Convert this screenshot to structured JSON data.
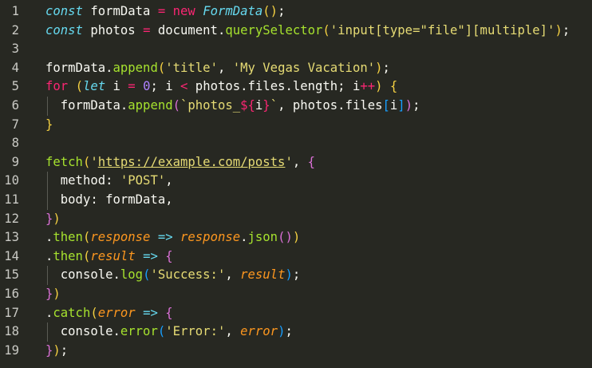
{
  "editor": {
    "colors": {
      "background": "#272822",
      "line_number": "#c9c9c4",
      "keyword": "#66d9ef",
      "control": "#f92672",
      "string": "#e6db74",
      "function": "#a6e22e",
      "parameter": "#fd971f",
      "number": "#ae81ff",
      "bracket_1": "#f5d142",
      "bracket_2": "#da70d6",
      "bracket_3": "#179fff"
    },
    "lines": [
      {
        "num": "1",
        "tokens": [
          {
            "t": "const",
            "c": "kw"
          },
          {
            "t": " formData ",
            "c": "var"
          },
          {
            "t": "=",
            "c": "op"
          },
          {
            "t": " ",
            "c": "var"
          },
          {
            "t": "new",
            "c": "ctrl"
          },
          {
            "t": " ",
            "c": "var"
          },
          {
            "t": "FormData",
            "c": "cls"
          },
          {
            "t": "()",
            "c": "b1"
          },
          {
            "t": ";",
            "c": "punc"
          }
        ]
      },
      {
        "num": "2",
        "tokens": [
          {
            "t": "const",
            "c": "kw"
          },
          {
            "t": " photos ",
            "c": "var"
          },
          {
            "t": "=",
            "c": "op"
          },
          {
            "t": " document.",
            "c": "var"
          },
          {
            "t": "querySelector",
            "c": "fn"
          },
          {
            "t": "(",
            "c": "b1"
          },
          {
            "t": "'input[type=\"file\"][multiple]'",
            "c": "str"
          },
          {
            "t": ")",
            "c": "b1"
          },
          {
            "t": ";",
            "c": "punc"
          }
        ]
      },
      {
        "num": "3",
        "tokens": []
      },
      {
        "num": "4",
        "tokens": [
          {
            "t": "formData.",
            "c": "var"
          },
          {
            "t": "append",
            "c": "fn"
          },
          {
            "t": "(",
            "c": "b1"
          },
          {
            "t": "'title'",
            "c": "str"
          },
          {
            "t": ", ",
            "c": "punc"
          },
          {
            "t": "'My Vegas Vacation'",
            "c": "str"
          },
          {
            "t": ")",
            "c": "b1"
          },
          {
            "t": ";",
            "c": "punc"
          }
        ]
      },
      {
        "num": "5",
        "tokens": [
          {
            "t": "for",
            "c": "ctrl"
          },
          {
            "t": " ",
            "c": "var"
          },
          {
            "t": "(",
            "c": "b1"
          },
          {
            "t": "let",
            "c": "kw"
          },
          {
            "t": " i ",
            "c": "var"
          },
          {
            "t": "=",
            "c": "op"
          },
          {
            "t": " ",
            "c": "var"
          },
          {
            "t": "0",
            "c": "num"
          },
          {
            "t": "; i ",
            "c": "var"
          },
          {
            "t": "<",
            "c": "op"
          },
          {
            "t": " photos.files.length; i",
            "c": "var"
          },
          {
            "t": "++",
            "c": "op"
          },
          {
            "t": ")",
            "c": "b1"
          },
          {
            "t": " ",
            "c": "var"
          },
          {
            "t": "{",
            "c": "b1"
          }
        ]
      },
      {
        "num": "6",
        "guide": true,
        "tokens": [
          {
            "t": "  formData.",
            "c": "var"
          },
          {
            "t": "append",
            "c": "fn"
          },
          {
            "t": "(",
            "c": "b2"
          },
          {
            "t": "`photos_",
            "c": "str"
          },
          {
            "t": "${",
            "c": "ctrl"
          },
          {
            "t": "i",
            "c": "var"
          },
          {
            "t": "}",
            "c": "ctrl"
          },
          {
            "t": "`",
            "c": "str"
          },
          {
            "t": ", photos.files",
            "c": "var"
          },
          {
            "t": "[",
            "c": "b3"
          },
          {
            "t": "i",
            "c": "var"
          },
          {
            "t": "]",
            "c": "b3"
          },
          {
            "t": ")",
            "c": "b2"
          },
          {
            "t": ";",
            "c": "punc"
          }
        ]
      },
      {
        "num": "7",
        "tokens": [
          {
            "t": "}",
            "c": "b1"
          }
        ]
      },
      {
        "num": "8",
        "tokens": []
      },
      {
        "num": "9",
        "tokens": [
          {
            "t": "fetch",
            "c": "fn"
          },
          {
            "t": "(",
            "c": "b1"
          },
          {
            "t": "'",
            "c": "str"
          },
          {
            "t": "https://example.com/posts",
            "c": "url"
          },
          {
            "t": "'",
            "c": "str"
          },
          {
            "t": ", ",
            "c": "punc"
          },
          {
            "t": "{",
            "c": "b2"
          }
        ]
      },
      {
        "num": "10",
        "guide": true,
        "tokens": [
          {
            "t": "  method: ",
            "c": "var"
          },
          {
            "t": "'POST'",
            "c": "str"
          },
          {
            "t": ",",
            "c": "punc"
          }
        ]
      },
      {
        "num": "11",
        "guide": true,
        "tokens": [
          {
            "t": "  body: formData,",
            "c": "var"
          }
        ]
      },
      {
        "num": "12",
        "tokens": [
          {
            "t": "}",
            "c": "b2"
          },
          {
            "t": ")",
            "c": "b1"
          }
        ]
      },
      {
        "num": "13",
        "tokens": [
          {
            "t": ".",
            "c": "punc"
          },
          {
            "t": "then",
            "c": "fn"
          },
          {
            "t": "(",
            "c": "b1"
          },
          {
            "t": "response",
            "c": "param"
          },
          {
            "t": " ",
            "c": "var"
          },
          {
            "t": "=>",
            "c": "kw"
          },
          {
            "t": " ",
            "c": "var"
          },
          {
            "t": "response",
            "c": "param"
          },
          {
            "t": ".",
            "c": "punc"
          },
          {
            "t": "json",
            "c": "fn"
          },
          {
            "t": "()",
            "c": "b2"
          },
          {
            "t": ")",
            "c": "b1"
          }
        ]
      },
      {
        "num": "14",
        "tokens": [
          {
            "t": ".",
            "c": "punc"
          },
          {
            "t": "then",
            "c": "fn"
          },
          {
            "t": "(",
            "c": "b1"
          },
          {
            "t": "result",
            "c": "param"
          },
          {
            "t": " ",
            "c": "var"
          },
          {
            "t": "=>",
            "c": "kw"
          },
          {
            "t": " ",
            "c": "var"
          },
          {
            "t": "{",
            "c": "b2"
          }
        ]
      },
      {
        "num": "15",
        "guide": true,
        "tokens": [
          {
            "t": "  console.",
            "c": "var"
          },
          {
            "t": "log",
            "c": "fn"
          },
          {
            "t": "(",
            "c": "b3"
          },
          {
            "t": "'Success:'",
            "c": "str"
          },
          {
            "t": ", ",
            "c": "punc"
          },
          {
            "t": "result",
            "c": "param"
          },
          {
            "t": ")",
            "c": "b3"
          },
          {
            "t": ";",
            "c": "punc"
          }
        ]
      },
      {
        "num": "16",
        "tokens": [
          {
            "t": "}",
            "c": "b2"
          },
          {
            "t": ")",
            "c": "b1"
          }
        ]
      },
      {
        "num": "17",
        "tokens": [
          {
            "t": ".",
            "c": "punc"
          },
          {
            "t": "catch",
            "c": "fn"
          },
          {
            "t": "(",
            "c": "b1"
          },
          {
            "t": "error",
            "c": "param"
          },
          {
            "t": " ",
            "c": "var"
          },
          {
            "t": "=>",
            "c": "kw"
          },
          {
            "t": " ",
            "c": "var"
          },
          {
            "t": "{",
            "c": "b2"
          }
        ]
      },
      {
        "num": "18",
        "guide": true,
        "tokens": [
          {
            "t": "  console.",
            "c": "var"
          },
          {
            "t": "error",
            "c": "fn"
          },
          {
            "t": "(",
            "c": "b3"
          },
          {
            "t": "'Error:'",
            "c": "str"
          },
          {
            "t": ", ",
            "c": "punc"
          },
          {
            "t": "error",
            "c": "param"
          },
          {
            "t": ")",
            "c": "b3"
          },
          {
            "t": ";",
            "c": "punc"
          }
        ]
      },
      {
        "num": "19",
        "tokens": [
          {
            "t": "}",
            "c": "b2"
          },
          {
            "t": ")",
            "c": "b1"
          },
          {
            "t": ";",
            "c": "punc"
          }
        ]
      }
    ]
  }
}
